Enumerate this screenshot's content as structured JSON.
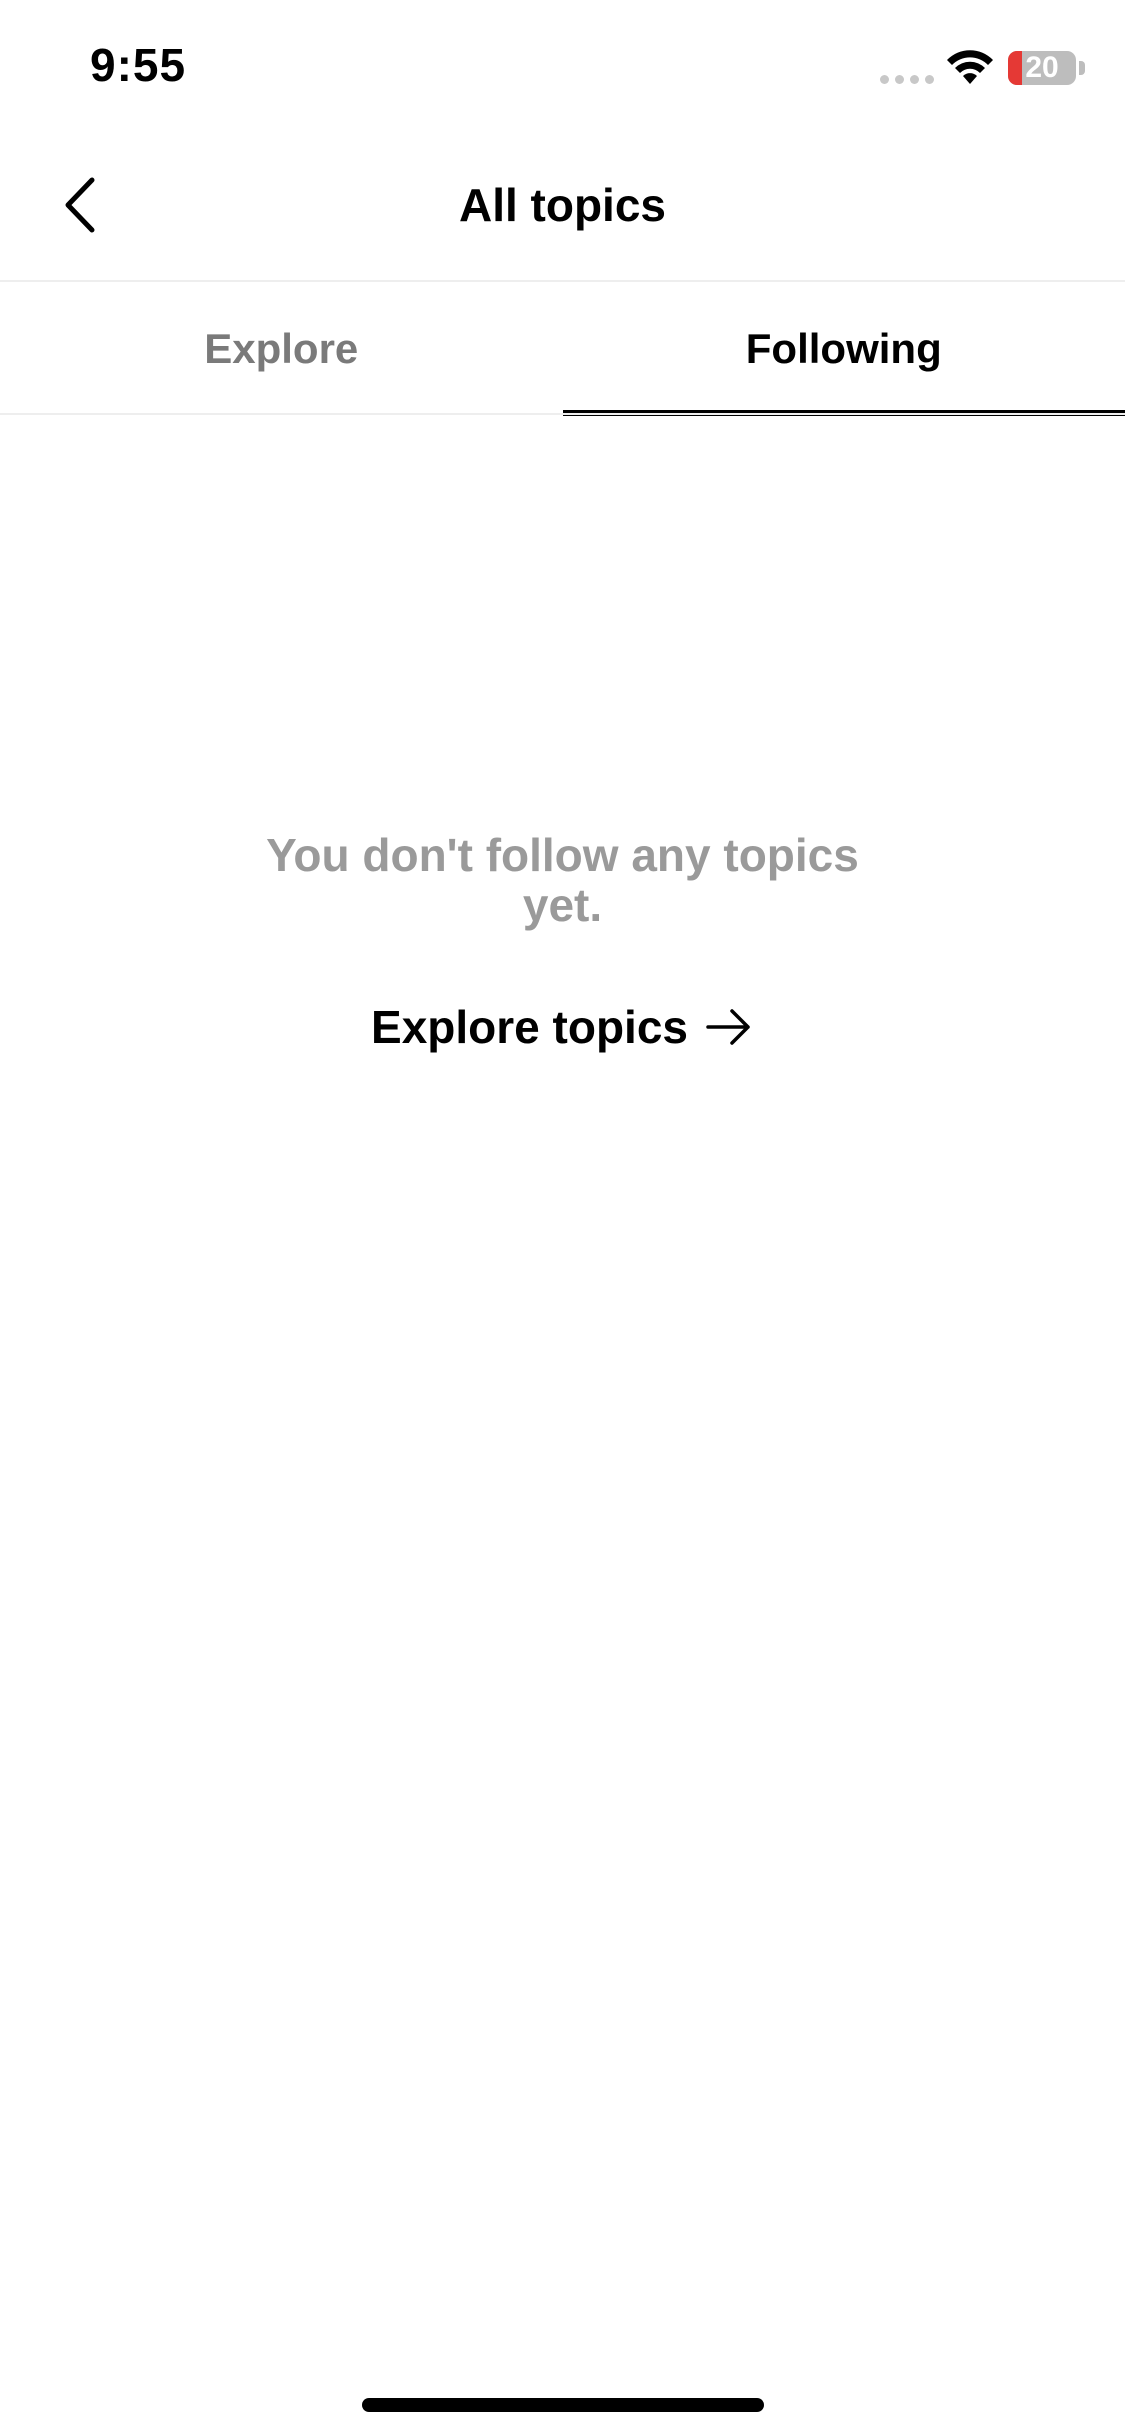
{
  "status_bar": {
    "time": "9:55",
    "battery_level": "20",
    "battery_fraction": 0.2,
    "icons": [
      "signal-icon",
      "wifi-icon",
      "battery-icon"
    ]
  },
  "nav": {
    "title": "All topics",
    "back_icon": "chevron-left-icon"
  },
  "tabs": [
    {
      "label": "Explore",
      "active": false
    },
    {
      "label": "Following",
      "active": true
    }
  ],
  "empty_state": {
    "message": "You don't follow any topics yet.",
    "link_label": "Explore topics",
    "link_icon": "arrow-right-icon"
  },
  "colors": {
    "battery_low": "#e53935",
    "inactive_tab": "#7a7a7a",
    "empty_text": "#9a9a9a",
    "accent": "#000000"
  }
}
